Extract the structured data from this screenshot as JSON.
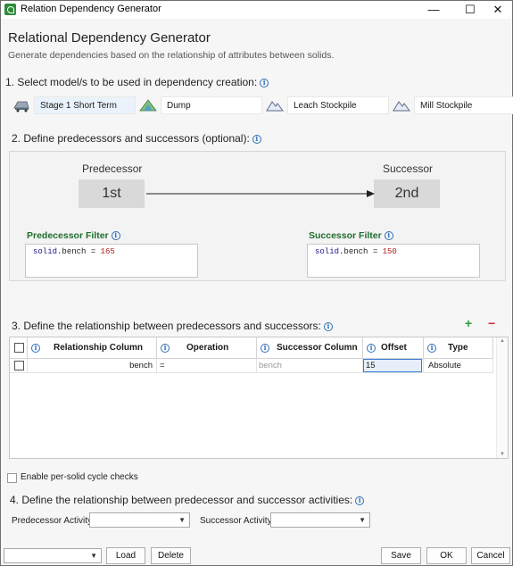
{
  "window": {
    "title": "Relation Dependency Generator"
  },
  "header": {
    "title": "Relational Dependency Generator",
    "subtitle": "Generate dependencies based on the relationship of attributes between solids."
  },
  "steps": {
    "step1": "1. Select model/s to be used in dependency creation:",
    "step2": "2. Define predecessors and successors (optional):",
    "step3": "3. Define the relationship between predecessors and successors:",
    "step4": "4. Define the relationship between predecessor and successor activities:"
  },
  "models": [
    {
      "label": "Stage 1 Short Term",
      "icon": "mining-truck-icon",
      "selected": true
    },
    {
      "label": "Dump",
      "icon": "dump-pile-icon",
      "selected": false
    },
    {
      "label": "Leach Stockpile",
      "icon": "mountain-outline-icon",
      "selected": false
    },
    {
      "label": "Mill Stockpile",
      "icon": "mountain-outline-icon",
      "selected": false
    }
  ],
  "graph": {
    "predecessor_label": "Predecessor",
    "successor_label": "Successor",
    "predecessor_node": "1st",
    "successor_node": "2nd"
  },
  "filters": {
    "predecessor_title": "Predecessor Filter",
    "predecessor_obj": "solid",
    "predecessor_field": ".bench",
    "predecessor_op": " = ",
    "predecessor_value": "165",
    "successor_title": "Successor Filter",
    "successor_obj": "solid",
    "successor_field": ".bench",
    "successor_op": " = ",
    "successor_value": "150"
  },
  "table": {
    "columns": [
      "Relationship Column",
      "Operation",
      "Successor Column",
      "Offset",
      "Type"
    ],
    "rows": [
      {
        "relationship_column": "bench",
        "operation": "=",
        "successor_column": "bench",
        "offset": "15",
        "type": "Absolute"
      }
    ]
  },
  "cycle_check_label": "Enable per-solid cycle checks",
  "activities": {
    "predecessor_label": "Predecessor Activity",
    "predecessor_value": "",
    "successor_label": "Successor Activity",
    "successor_value": ""
  },
  "footer": {
    "preset_value": "",
    "load": "Load",
    "delete": "Delete",
    "save": "Save",
    "ok": "OK",
    "cancel": "Cancel"
  },
  "icons": {
    "info": "i",
    "add": "+",
    "remove": "−",
    "minimize": "—",
    "maximize": "☐",
    "close": "✕",
    "dropdown": "▼"
  },
  "colors": {
    "accent_green": "#1f6e2d",
    "add_green": "#2e9a3a",
    "remove_red": "#d42a2a",
    "info_blue": "#2f6fb5"
  }
}
